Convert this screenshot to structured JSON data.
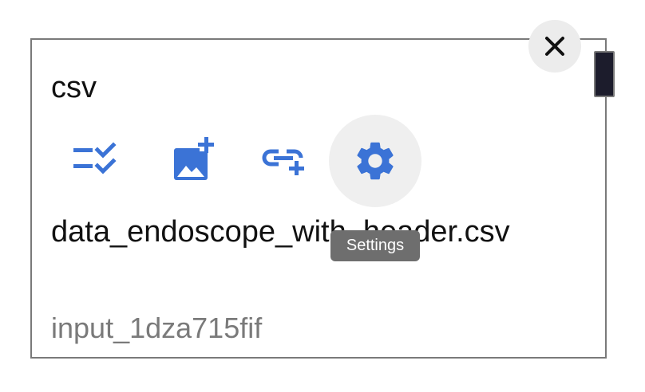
{
  "node": {
    "title": "csv",
    "filename": "data_endoscope_with_header.csv",
    "input_id": "input_1dza715fif"
  },
  "toolbar": {
    "items": [
      {
        "icon": "checklist-icon",
        "name": "select-columns"
      },
      {
        "icon": "add-photo-icon",
        "name": "add-image"
      },
      {
        "icon": "add-link-icon",
        "name": "add-link"
      },
      {
        "icon": "gear-icon",
        "name": "settings"
      }
    ],
    "tooltip": "Settings"
  },
  "colors": {
    "icon_blue": "#3b73d6",
    "border": "#7a7a7a",
    "tooltip_bg": "#6e6e6e"
  },
  "close_icon": "close-icon"
}
